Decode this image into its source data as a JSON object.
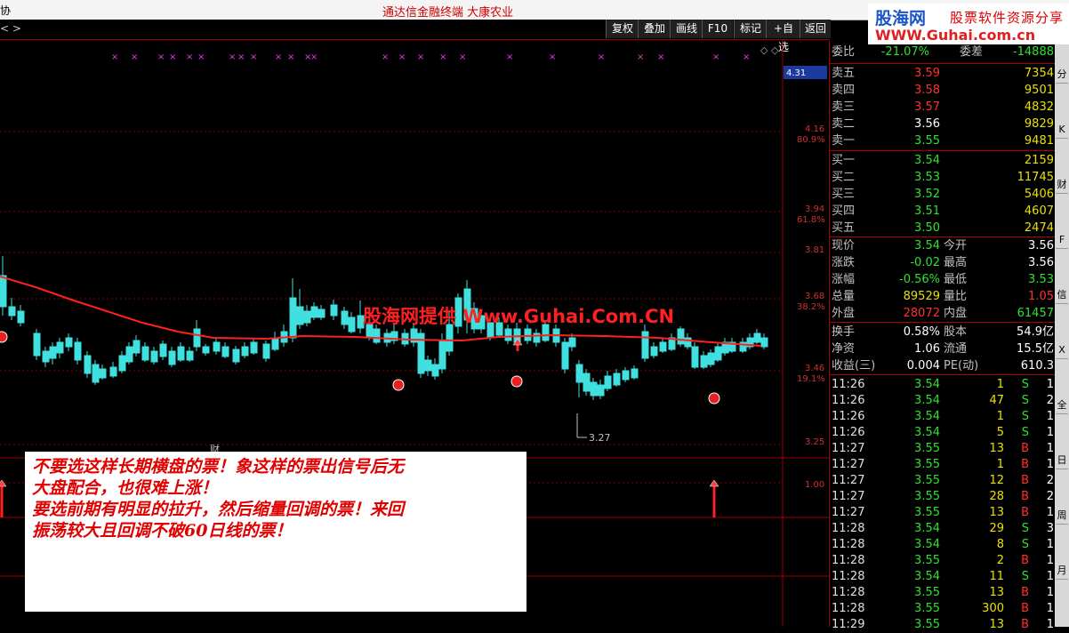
{
  "window": {
    "title": "通达信金融终端   大康农业",
    "edge_char": "协"
  },
  "toolbar": {
    "nav": "<   >",
    "buttons": [
      "复权",
      "叠加",
      "画线",
      "F10",
      "标记",
      "+自选",
      "返回"
    ]
  },
  "logo": {
    "brand": "股海网",
    "slogan": "股票软件资源分享",
    "url": "WWW.Guhai.com.cn"
  },
  "chart": {
    "price_box": "4.31",
    "y_labels": [
      {
        "price": "4.16",
        "pct": "80.9%"
      },
      {
        "price": "3.94",
        "pct": "61.8%"
      },
      {
        "price": "3.81",
        "pct": ""
      },
      {
        "price": "3.68",
        "pct": "38.2%"
      },
      {
        "price": "3.46",
        "pct": "19.1%"
      },
      {
        "price": "3.25",
        "pct": ""
      }
    ],
    "low_annotation": "3.27",
    "indicator_label": "1.00",
    "small_marker": "财"
  },
  "chart_data": {
    "type": "candlestick",
    "ma_color": "#ff2020",
    "up_color": "#ff3030",
    "down_color": "#40e0e0",
    "low_marker": 3.27
  },
  "watermark": "股海网提供 Www.Guhai.Com.CN",
  "note": {
    "lines": [
      "不要选这样长期横盘的票！象这样的票出信号后无",
      "大盘配合，也很难上涨！",
      "要选前期有明显的拉升，然后缩量回调的票！来回",
      "振荡较大且回调不破60日线的票！"
    ]
  },
  "quote": {
    "weibi": {
      "label": "委比",
      "value": "-21.07%",
      "label2": "委差",
      "value2": "-14888"
    },
    "asks": [
      {
        "label": "卖五",
        "price": "3.59",
        "vol": "7354"
      },
      {
        "label": "卖四",
        "price": "3.58",
        "vol": "9501"
      },
      {
        "label": "卖三",
        "price": "3.57",
        "vol": "4832"
      },
      {
        "label": "卖二",
        "price": "3.56",
        "vol": "9829"
      },
      {
        "label": "卖一",
        "price": "3.55",
        "vol": "9481"
      }
    ],
    "bids": [
      {
        "label": "买一",
        "price": "3.54",
        "vol": "2159"
      },
      {
        "label": "买二",
        "price": "3.53",
        "vol": "11745"
      },
      {
        "label": "买三",
        "price": "3.52",
        "vol": "5406"
      },
      {
        "label": "买四",
        "price": "3.51",
        "vol": "4607"
      },
      {
        "label": "买五",
        "price": "3.50",
        "vol": "2474"
      }
    ],
    "stats": [
      {
        "l1": "现价",
        "v1": "3.54",
        "l2": "今开",
        "v2": "3.56"
      },
      {
        "l1": "涨跌",
        "v1": "-0.02",
        "l2": "最高",
        "v2": "3.56"
      },
      {
        "l1": "涨幅",
        "v1": "-0.56%",
        "l2": "最低",
        "v2": "3.53"
      },
      {
        "l1": "总量",
        "v1": "89529",
        "l2": "量比",
        "v2": "1.05"
      },
      {
        "l1": "外盘",
        "v1": "28072",
        "l2": "内盘",
        "v2": "61457"
      }
    ],
    "stats2": [
      {
        "l1": "换手",
        "v1": "0.58%",
        "l2": "股本",
        "v2": "54.9亿"
      },
      {
        "l1": "净资",
        "v1": "1.06",
        "l2": "流通",
        "v2": "15.5亿"
      },
      {
        "l1": "收益(三)",
        "v1": "0.004",
        "l2": "PE(动)",
        "v2": "610.3"
      }
    ],
    "ticks": [
      {
        "time": "11:26",
        "price": "3.54",
        "vol": "1",
        "side": "S",
        "n": "1"
      },
      {
        "time": "11:26",
        "price": "3.54",
        "vol": "47",
        "side": "S",
        "n": "2"
      },
      {
        "time": "11:26",
        "price": "3.54",
        "vol": "1",
        "side": "S",
        "n": "1"
      },
      {
        "time": "11:26",
        "price": "3.54",
        "vol": "5",
        "side": "S",
        "n": "1"
      },
      {
        "time": "11:27",
        "price": "3.55",
        "vol": "13",
        "side": "B",
        "n": "1"
      },
      {
        "time": "11:27",
        "price": "3.55",
        "vol": "1",
        "side": "B",
        "n": "1"
      },
      {
        "time": "11:27",
        "price": "3.55",
        "vol": "12",
        "side": "B",
        "n": "2"
      },
      {
        "time": "11:27",
        "price": "3.55",
        "vol": "28",
        "side": "B",
        "n": "2"
      },
      {
        "time": "11:27",
        "price": "3.55",
        "vol": "13",
        "side": "B",
        "n": "1"
      },
      {
        "time": "11:28",
        "price": "3.54",
        "vol": "29",
        "side": "S",
        "n": "3"
      },
      {
        "time": "11:28",
        "price": "3.54",
        "vol": "8",
        "side": "S",
        "n": "1"
      },
      {
        "time": "11:28",
        "price": "3.55",
        "vol": "2",
        "side": "B",
        "n": "1"
      },
      {
        "time": "11:28",
        "price": "3.54",
        "vol": "11",
        "side": "S",
        "n": "1"
      },
      {
        "time": "11:28",
        "price": "3.55",
        "vol": "13",
        "side": "B",
        "n": "1"
      },
      {
        "time": "11:28",
        "price": "3.55",
        "vol": "300",
        "side": "B",
        "n": "1"
      },
      {
        "time": "11:29",
        "price": "3.55",
        "vol": "13",
        "side": "B",
        "n": "1"
      }
    ]
  },
  "side_tabs": [
    "分",
    "K",
    "财",
    "F",
    "信",
    "X",
    "全",
    "日",
    "周",
    "月"
  ],
  "colors": {
    "up": "#ff3030",
    "down": "#30e030",
    "flat": "#ffffff",
    "yellow": "#e8e000"
  }
}
